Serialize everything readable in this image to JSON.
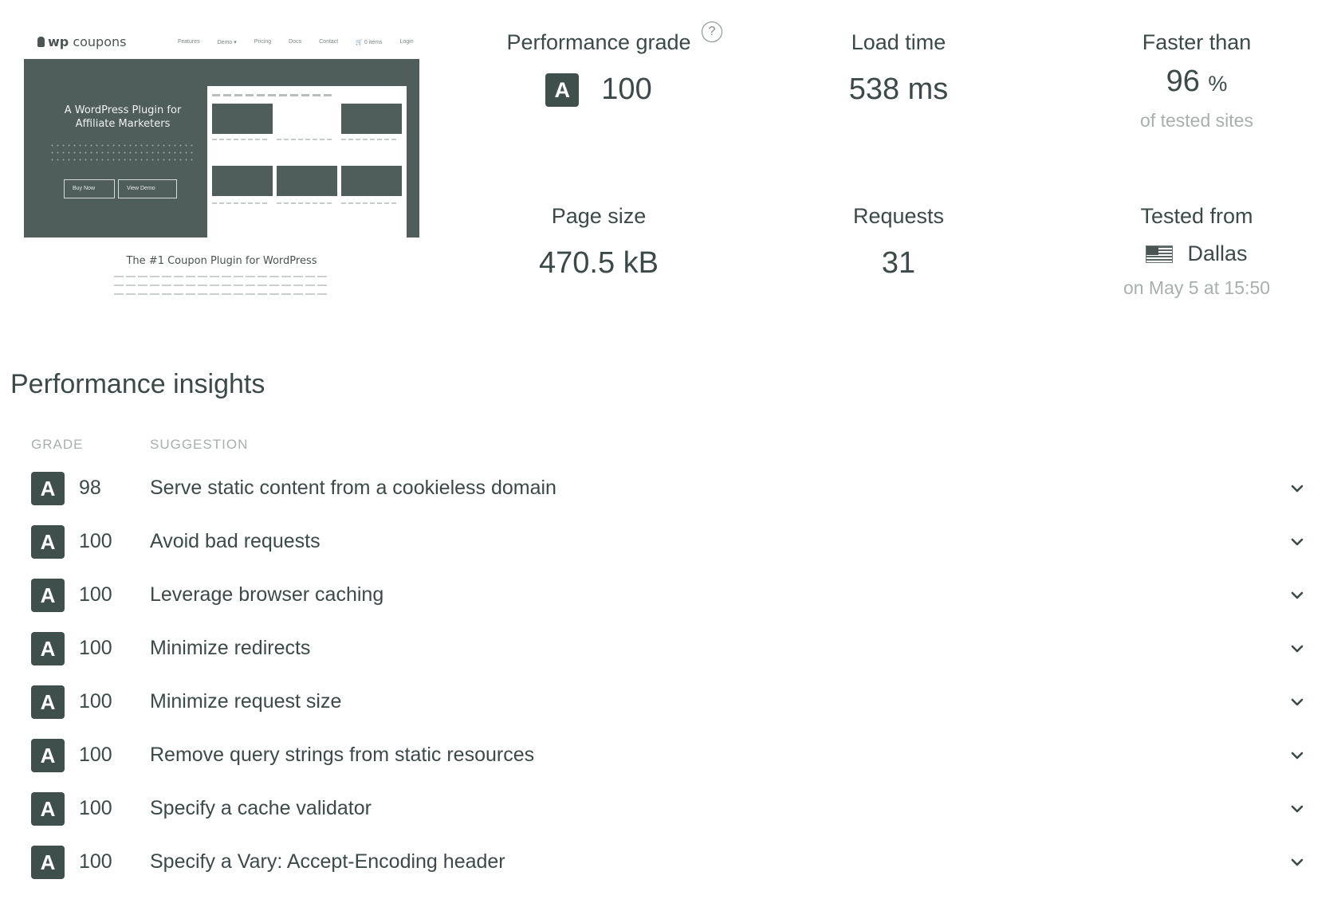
{
  "thumbnail": {
    "logo_prefix": "wp",
    "logo_suffix": " coupons",
    "menu": [
      "Features",
      "Demo ▾",
      "Pricing",
      "Docs",
      "Contact",
      "🛒 0 items",
      "Login"
    ],
    "hero_title": "A WordPress Plugin for Affiliate Marketers",
    "buy_label": "Buy Now",
    "demo_label": "View Demo",
    "caption": "The #1 Coupon Plugin for WordPress"
  },
  "stats": {
    "performance_grade": {
      "label": "Performance grade",
      "grade": "A",
      "value": "100",
      "help": "?"
    },
    "load_time": {
      "label": "Load time",
      "value": "538 ms"
    },
    "faster_than": {
      "label": "Faster than",
      "value": "96",
      "unit": "%",
      "sub": "of tested sites"
    },
    "page_size": {
      "label": "Page size",
      "value": "470.5 kB"
    },
    "requests": {
      "label": "Requests",
      "value": "31"
    },
    "tested_from": {
      "label": "Tested from",
      "location": "Dallas",
      "flag_icon": "us-flag-icon",
      "sub": "on May 5 at 15:50"
    }
  },
  "insights": {
    "title": "Performance insights",
    "columns": {
      "grade": "GRADE",
      "suggestion": "SUGGESTION"
    },
    "rows": [
      {
        "grade": "A",
        "score": "98",
        "suggestion": "Serve static content from a cookieless domain"
      },
      {
        "grade": "A",
        "score": "100",
        "suggestion": "Avoid bad requests"
      },
      {
        "grade": "A",
        "score": "100",
        "suggestion": "Leverage browser caching"
      },
      {
        "grade": "A",
        "score": "100",
        "suggestion": "Minimize redirects"
      },
      {
        "grade": "A",
        "score": "100",
        "suggestion": "Minimize request size"
      },
      {
        "grade": "A",
        "score": "100",
        "suggestion": "Remove query strings from static resources"
      },
      {
        "grade": "A",
        "score": "100",
        "suggestion": "Specify a cache validator"
      },
      {
        "grade": "A",
        "score": "100",
        "suggestion": "Specify a Vary: Accept-Encoding header"
      }
    ]
  },
  "colors": {
    "badge": "#3f4f4c",
    "text": "#3b4a48",
    "muted": "#a7b0ae",
    "hero": "#4f5e5b"
  }
}
